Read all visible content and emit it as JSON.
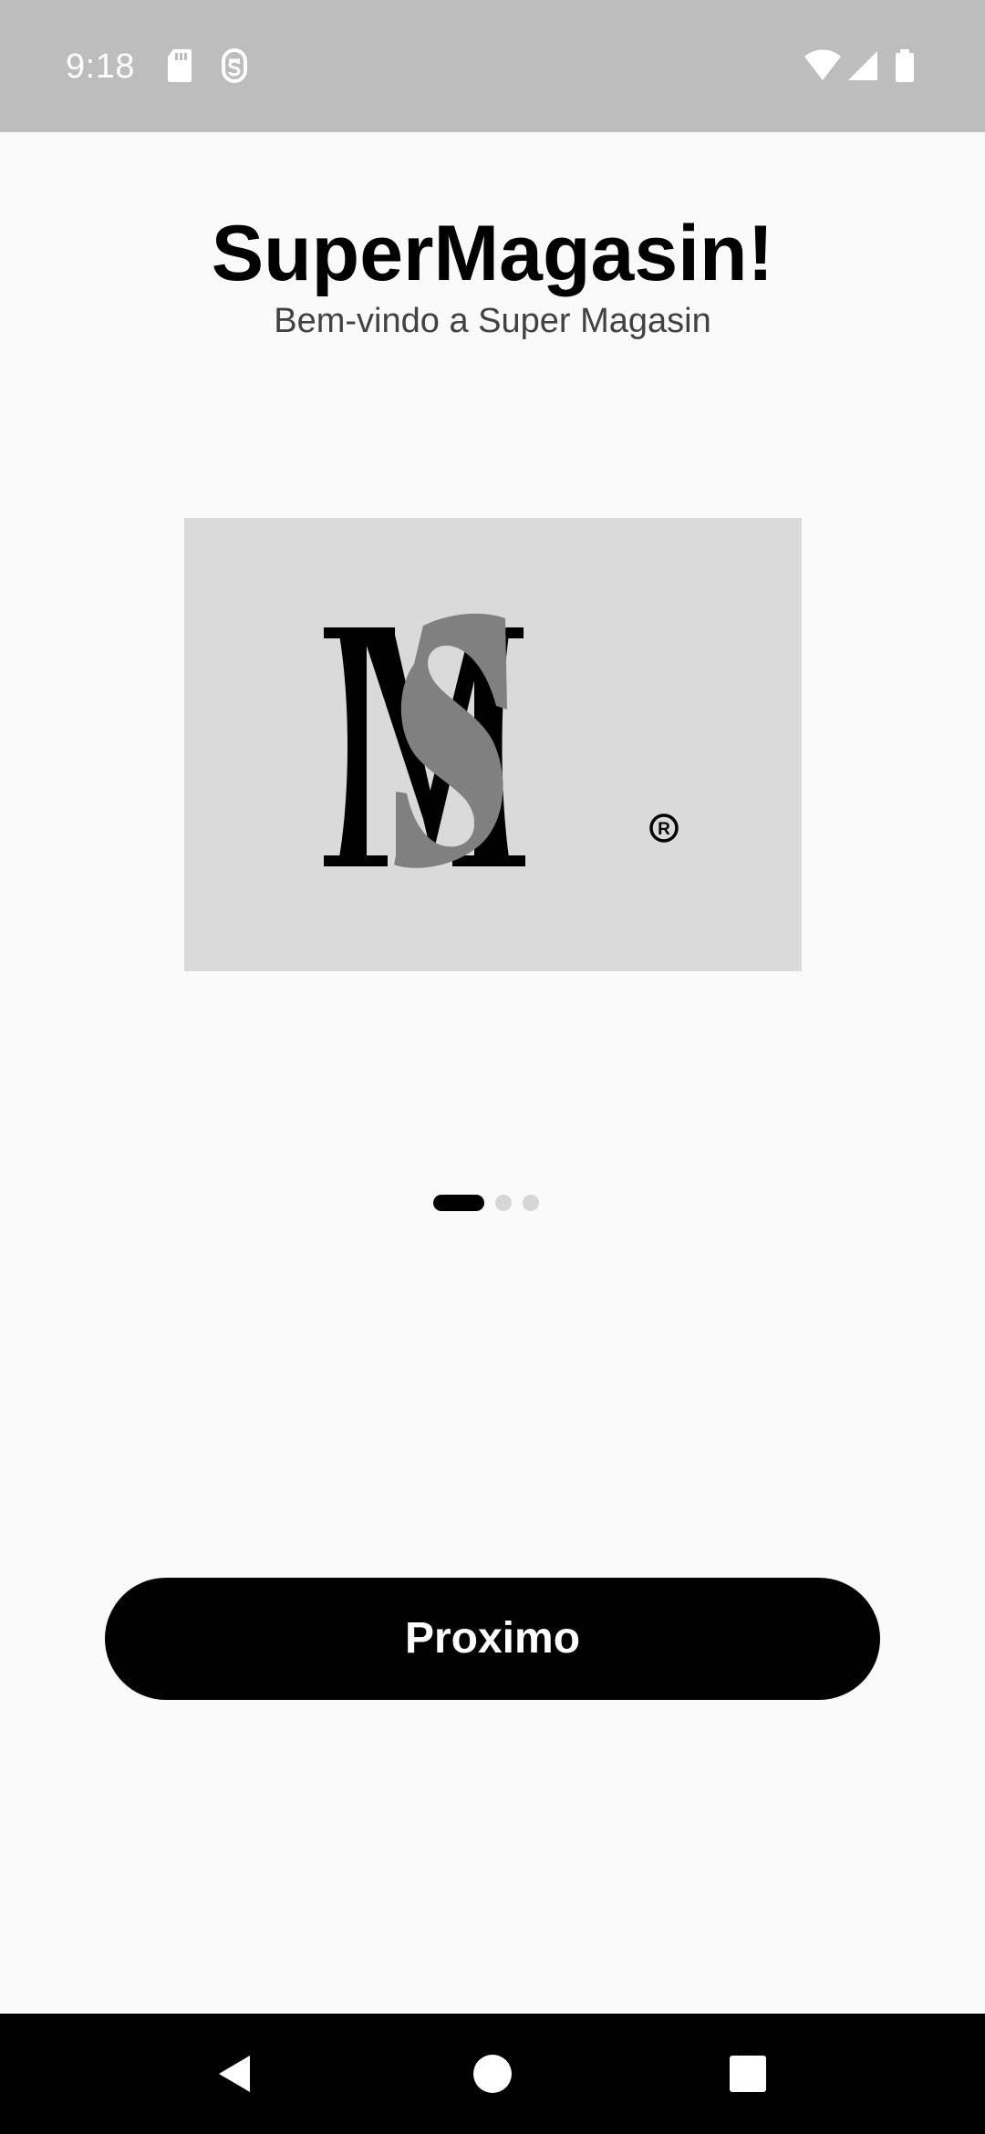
{
  "status_bar": {
    "time": "9:18",
    "left_icons": [
      "sd-card-icon",
      "sim-toolkit-icon"
    ],
    "right_icons": [
      "wifi-icon",
      "cellular-signal-icon",
      "battery-icon"
    ],
    "background": "#BDBDBD"
  },
  "header": {
    "title": "SuperMagasin!",
    "subtitle": "Bem-vindo a Super Magasin"
  },
  "logo": {
    "icon": "supermagasin-logo",
    "letters": "SM",
    "registered_mark": "®",
    "card_background": "#DADADA",
    "m_color": "#000000",
    "s_color": "#808080"
  },
  "pager": {
    "total_pages": 3,
    "current_page": 1
  },
  "actions": {
    "next_label": "Proximo"
  },
  "nav_bar": {
    "buttons": [
      "back-icon",
      "home-icon",
      "recents-icon"
    ]
  },
  "colors": {
    "background": "#FAFAFA",
    "accent": "#000000",
    "inactive_dot": "#D6D6D6"
  }
}
